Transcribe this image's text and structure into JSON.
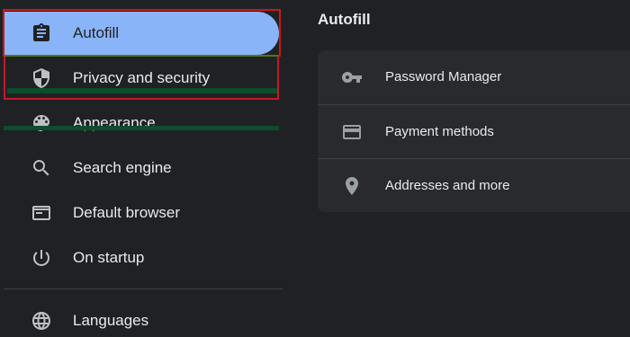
{
  "sidebar": {
    "items": [
      {
        "label": "Autofill",
        "icon": "clipboard-icon",
        "active": true
      },
      {
        "label": "Privacy and security",
        "icon": "shield-icon"
      },
      {
        "label": "Appearance",
        "icon": "palette-icon"
      },
      {
        "label": "Search engine",
        "icon": "search-icon"
      },
      {
        "label": "Default browser",
        "icon": "browser-window-icon"
      },
      {
        "label": "On startup",
        "icon": "power-icon"
      },
      {
        "label": "Languages",
        "icon": "globe-icon"
      }
    ]
  },
  "main": {
    "title": "Autofill",
    "rows": [
      {
        "label": "Password Manager",
        "icon": "key-icon"
      },
      {
        "label": "Payment methods",
        "icon": "credit-card-icon"
      },
      {
        "label": "Addresses and more",
        "icon": "location-pin-icon"
      }
    ]
  },
  "colors": {
    "background": "#202124",
    "card": "#292a2d",
    "accent": "#8ab4f8",
    "text": "#e8eaed",
    "icon": "#9aa0a6",
    "annotation_red": "#d01515"
  }
}
